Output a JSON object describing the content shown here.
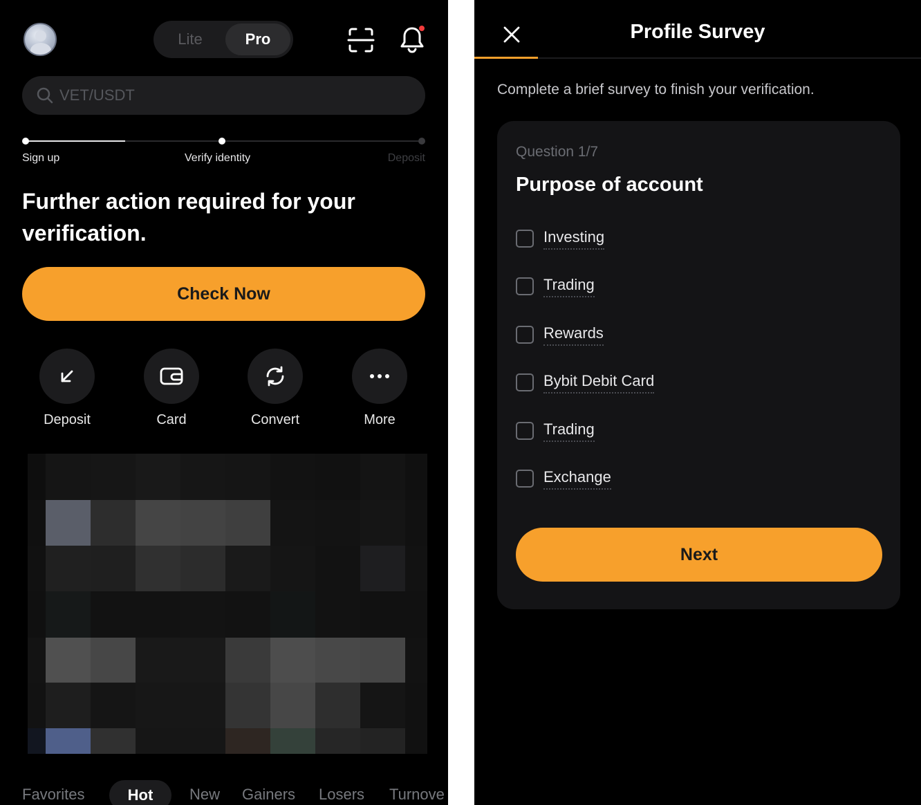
{
  "left": {
    "mode_toggle": {
      "lite": "Lite",
      "pro": "Pro"
    },
    "search": {
      "placeholder": "VET/USDT"
    },
    "progress": {
      "steps": [
        "Sign up",
        "Verify identity",
        "Deposit"
      ]
    },
    "headline": "Further action required for your verification.",
    "cta": "Check Now",
    "actions": [
      {
        "label": "Deposit",
        "icon": "arrow-down-left-icon"
      },
      {
        "label": "Card",
        "icon": "wallet-card-icon"
      },
      {
        "label": "Convert",
        "icon": "convert-icon"
      },
      {
        "label": "More",
        "icon": "more-dots-icon"
      }
    ],
    "tabs": [
      "Favorites",
      "Hot",
      "New",
      "Gainers",
      "Losers",
      "Turnove"
    ],
    "active_tab": "Hot"
  },
  "right": {
    "title": "Profile Survey",
    "intro": "Complete a brief survey to finish your verification.",
    "question_number": "Question 1/7",
    "question_title": "Purpose of account",
    "options": [
      "Investing",
      "Trading",
      "Rewards",
      "Bybit Debit Card",
      "Trading",
      "Exchange"
    ],
    "next": "Next"
  },
  "colors": {
    "accent": "#f7a02c",
    "background": "#000000",
    "surface": "#1c1c1e",
    "notification_dot": "#f23b3b"
  }
}
